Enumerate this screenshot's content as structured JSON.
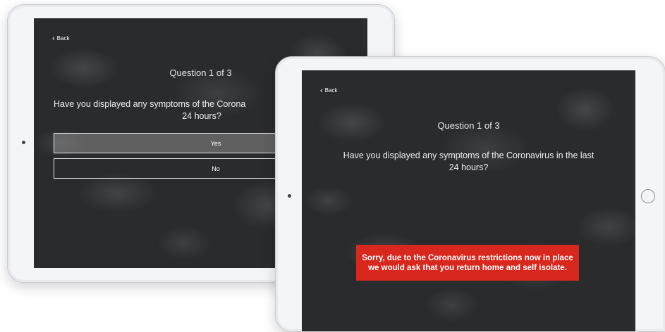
{
  "back_device": {
    "back_label": "Back",
    "question_count": "Question 1 of 3",
    "question_line1": "Have you displayed any symptoms of the Corona",
    "question_line2": "24 hours?",
    "answers": [
      "Yes",
      "No"
    ]
  },
  "front_device": {
    "back_label": "Back",
    "question_count": "Question 1 of 3",
    "question_line1": "Have you displayed any symptoms of the Coronavirus in the last",
    "question_line2": "24 hours?",
    "alert_line1": "Sorry, due to the Coronavirus restrictions now in place",
    "alert_line2": "we would ask that you return home and self isolate."
  },
  "colors": {
    "alert_red": "#d8281d",
    "screen_dark": "#2a2b2d",
    "device_frame": "#f4f5f7"
  },
  "icons": {
    "back": "chevron-left-icon",
    "home": "home-button-icon"
  }
}
